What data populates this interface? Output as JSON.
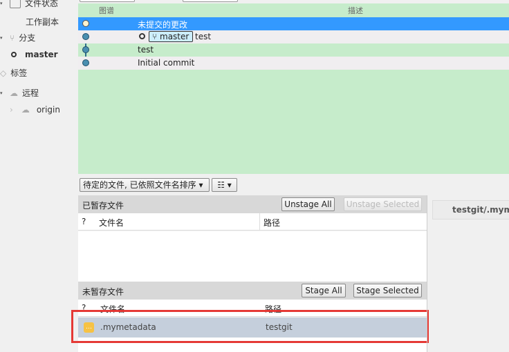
{
  "sidebar": {
    "items": [
      {
        "label": "文件状态"
      },
      {
        "label": "工作副本"
      },
      {
        "label": "分支"
      },
      {
        "label": "master"
      },
      {
        "label": "标签"
      },
      {
        "label": "远程"
      },
      {
        "label": "origin"
      }
    ]
  },
  "graph": {
    "columns": [
      "图谱",
      "描述"
    ],
    "rows": [
      {
        "desc": "未提交的更改",
        "selected": true
      },
      {
        "branch": "master",
        "desc": "test"
      },
      {
        "desc": "test"
      },
      {
        "desc": "Initial commit"
      }
    ]
  },
  "toolbar": {
    "filter": "待定的文件, 已依照文件名排序",
    "view_icon": "list-icon"
  },
  "staged": {
    "title": "已暂存文件",
    "unstage_all": "Unstage All",
    "unstage_selected": "Unstage Selected",
    "columns": [
      "?",
      "文件名",
      "路径"
    ]
  },
  "unstaged": {
    "title": "未暂存文件",
    "stage_all": "Stage All",
    "stage_selected": "Stage Selected",
    "columns": [
      "?",
      "文件名",
      "路径"
    ],
    "files": [
      {
        "name": ".mymetadata",
        "path": "testgit",
        "status": "modified"
      }
    ]
  },
  "diff": {
    "title": "testgit/.mymet"
  },
  "colors": {
    "selected": "#3399ff",
    "graph_bg": "#c6eccb",
    "highlight": "#e53935"
  }
}
